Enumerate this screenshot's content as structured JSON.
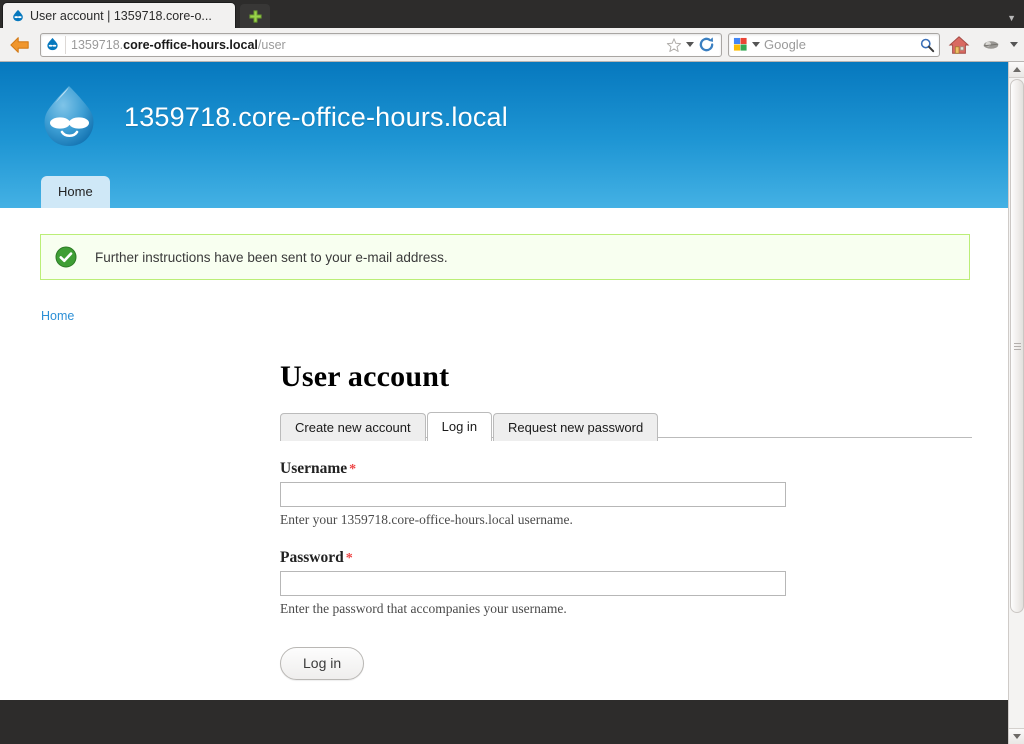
{
  "browser": {
    "tab": {
      "title": "User account | 1359718.core-o...",
      "favicon": "drupal-droplet-icon"
    },
    "new_tab_label": "+",
    "back_button": "back-arrow-icon",
    "url": {
      "prefix": "1359718.",
      "domain": "core-office-hours.local",
      "path": "/user",
      "full": "1359718.core-office-hours.local/user"
    },
    "bookmark_icon": "star-icon",
    "reload_icon": "reload-icon",
    "search": {
      "engine": "Google",
      "placeholder": "Google",
      "go_icon": "magnifier-icon"
    },
    "home_icon": "home-icon",
    "extras_icon": "extension-icon",
    "overflow_icon": "chevron-down-icon"
  },
  "site": {
    "logo": "drupal-droplet-logo",
    "name": "1359718.core-office-hours.local",
    "main_menu": [
      {
        "label": "Home",
        "active": true
      }
    ],
    "header_gradient_top": "#0678be",
    "header_gradient_bottom": "#44b1e4"
  },
  "message": {
    "type": "status",
    "icon": "check-circle-icon",
    "text": "Further instructions have been sent to your e-mail address.",
    "bg": "#f8fff0",
    "border": "#bbee77"
  },
  "breadcrumb": {
    "items": [
      {
        "label": "Home",
        "href": true
      }
    ]
  },
  "page": {
    "title": "User account",
    "tabs": [
      {
        "label": "Create new account",
        "active": false
      },
      {
        "label": "Log in",
        "active": true
      },
      {
        "label": "Request new password",
        "active": false
      }
    ]
  },
  "form": {
    "username": {
      "label": "Username",
      "required_marker": "*",
      "value": "",
      "placeholder": "",
      "description": "Enter your 1359718.core-office-hours.local username."
    },
    "password": {
      "label": "Password",
      "required_marker": "*",
      "value": "",
      "placeholder": "",
      "description": "Enter the password that accompanies your username."
    },
    "submit_label": "Log in"
  },
  "scrollbar": {
    "up_arrow": "scroll-up-icon",
    "down_arrow": "scroll-down-icon"
  }
}
